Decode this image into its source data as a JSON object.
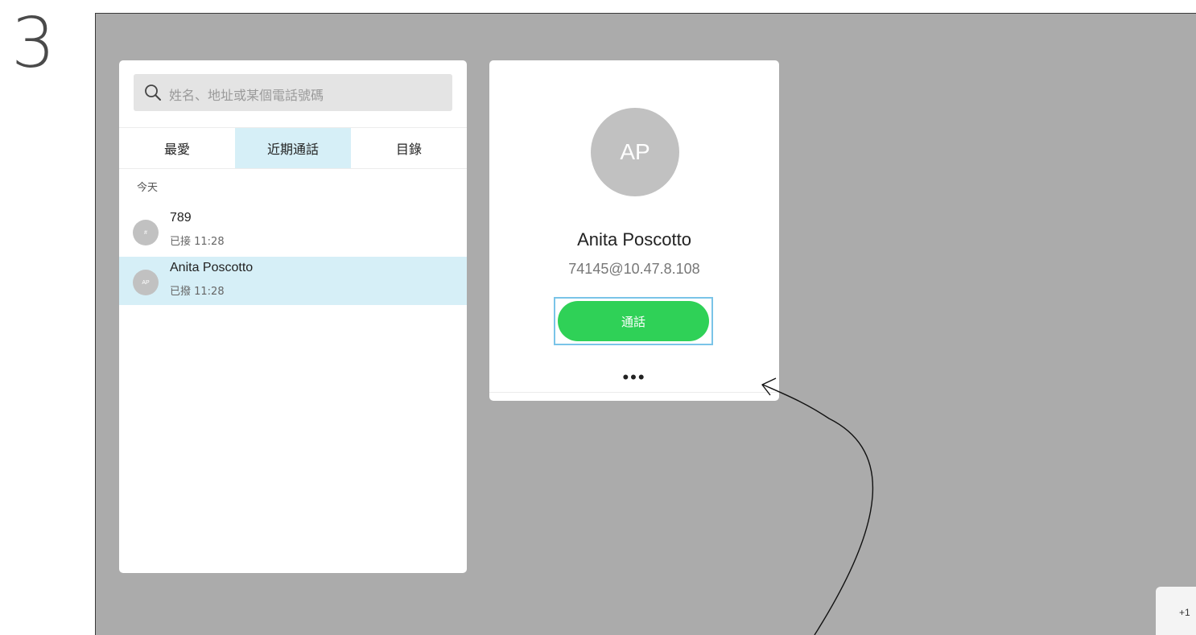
{
  "step": "3",
  "search": {
    "placeholder": "姓名、地址或某個電話號碼"
  },
  "tabs": [
    {
      "label": "最愛",
      "active": false
    },
    {
      "label": "近期通話",
      "active": true
    },
    {
      "label": "目錄",
      "active": false
    }
  ],
  "recents": {
    "section_label": "今天",
    "items": [
      {
        "avatar": "#",
        "name": "789",
        "detail": "已接 11:28",
        "selected": false
      },
      {
        "avatar": "AP",
        "name": "Anita Poscotto",
        "detail": "已撥 11:28",
        "selected": true
      }
    ]
  },
  "contact": {
    "initials": "AP",
    "name": "Anita Poscotto",
    "address": "74145@10.47.8.108",
    "call_label": "通話",
    "more_label": "•••"
  },
  "badge": {
    "label": "+1"
  },
  "colors": {
    "screen_bg": "#ababab",
    "selected_bg": "#d6eff7",
    "call_green": "#2fd157",
    "focus_blue": "#7ac4e8",
    "avatar_gray": "#c1c1c1"
  },
  "icons": {
    "search": "search-icon",
    "more": "more-options-icon",
    "annotation": "curved-arrow"
  }
}
